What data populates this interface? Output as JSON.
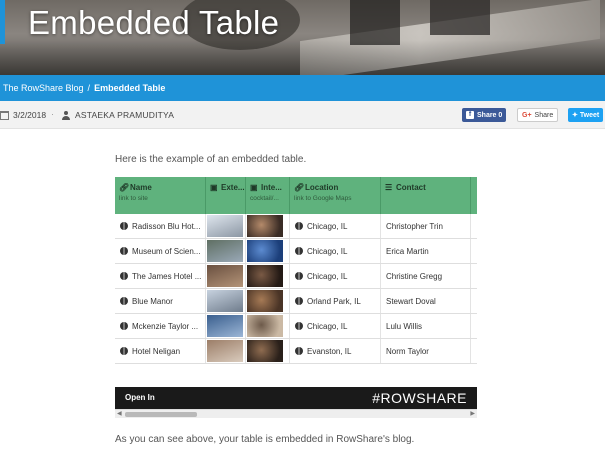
{
  "page": {
    "title": "Embedded Table",
    "breadcrumb": {
      "blog": "The RowShare Blog",
      "separator": "/",
      "current": "Embedded Table"
    },
    "meta": {
      "date": "3/2/2018",
      "dot": "·",
      "author": "ASTAEKA PRAMUDITYA"
    },
    "share": {
      "facebook": "Share 0",
      "facebook_icon": "f",
      "google": "Share",
      "google_icon": "G+",
      "twitter": "Tweet"
    },
    "intro": "Here is the example of an embedded table.",
    "outro": "As you can see above, your table is embedded in RowShare's blog."
  },
  "table": {
    "columns": [
      {
        "title": "Name",
        "subtitle": "link to site",
        "icon": "link-icon"
      },
      {
        "title": "Exte...",
        "subtitle": "",
        "icon": "image-icon"
      },
      {
        "title": "Inte...",
        "subtitle": "cocktail/...",
        "icon": "image-icon"
      },
      {
        "title": "Location",
        "subtitle": "link to Google Maps",
        "icon": "link-icon"
      },
      {
        "title": "Contact",
        "subtitle": "",
        "icon": "list-icon"
      }
    ],
    "rows": [
      {
        "name": "Radisson Blu Hot...",
        "location": "Chicago, IL",
        "contact": "Christopher Trin"
      },
      {
        "name": "Museum of Scien...",
        "location": "Chicago, IL",
        "contact": "Erica Martin"
      },
      {
        "name": "The James Hotel ...",
        "location": "Chicago, IL",
        "contact": "Christine Gregg"
      },
      {
        "name": "Blue Manor",
        "location": "Orland Park, IL",
        "contact": "Stewart Doval"
      },
      {
        "name": "Mckenzie Taylor ...",
        "location": "Chicago, IL",
        "contact": "Lulu Willis"
      },
      {
        "name": "Hotel Neligan",
        "location": "Evanston, IL",
        "contact": "Norm Taylor"
      }
    ],
    "footer": {
      "open_in": "Open In",
      "brand": "#ROWSHARE"
    }
  },
  "colors": {
    "blue_bar": "#1f93d8",
    "table_header": "#5fb27d",
    "embed_footer": "#1a1a1a"
  }
}
